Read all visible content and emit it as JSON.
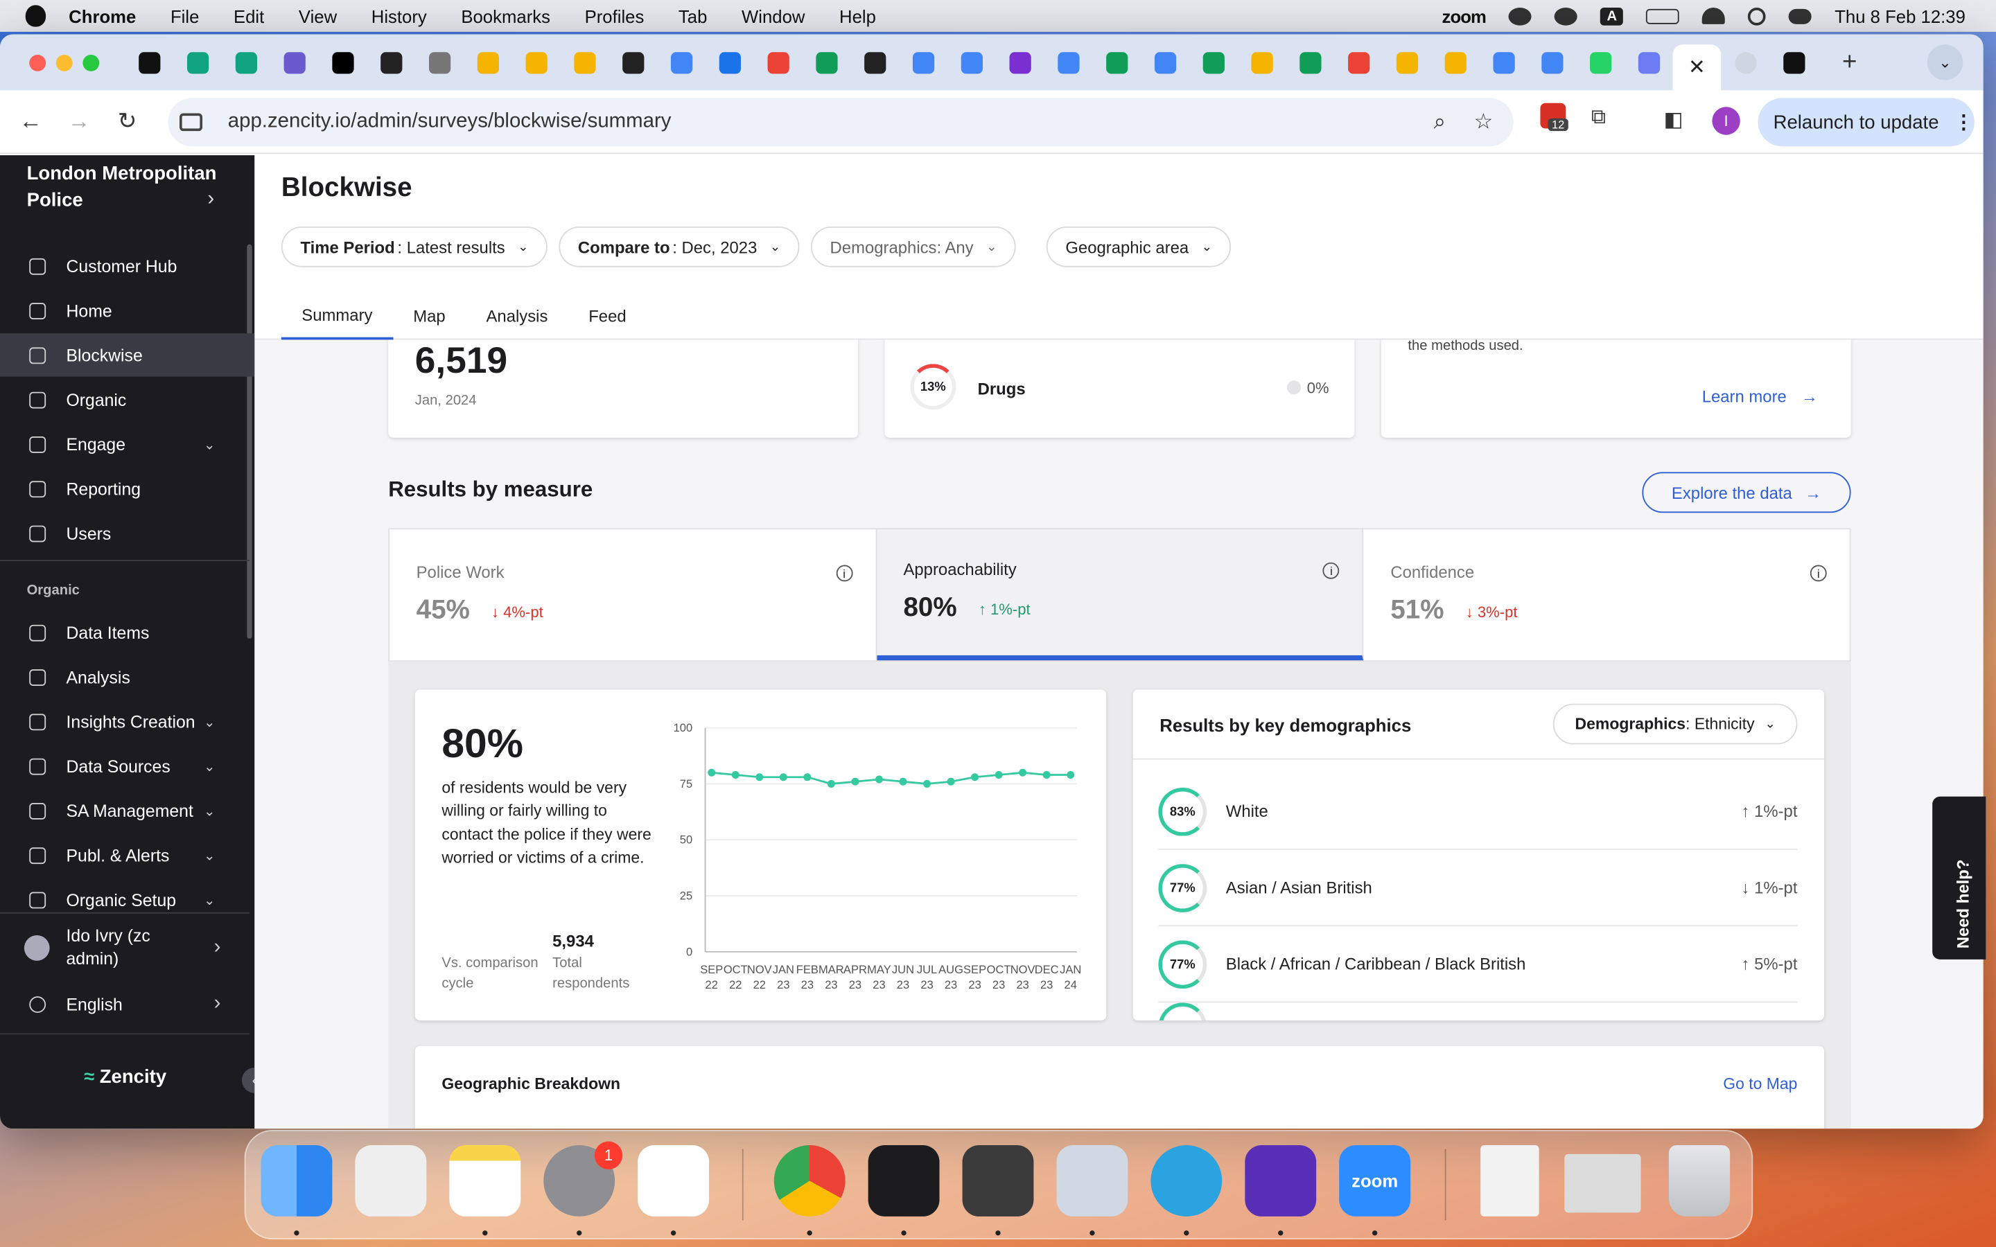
{
  "menubar": {
    "app": "Chrome",
    "items": [
      "File",
      "Edit",
      "View",
      "History",
      "Bookmarks",
      "Profiles",
      "Tab",
      "Window",
      "Help"
    ],
    "zoom": "zoom",
    "a_icon": "A",
    "datetime": "Thu 8 Feb  12:39"
  },
  "browser": {
    "url": "app.zencity.io/admin/surveys/blockwise/summary",
    "relaunch": "Relaunch to update",
    "ext_badge": "12",
    "profile_letter": "I",
    "close_tab": "✕",
    "new_tab": "+"
  },
  "sidebar": {
    "org_name": "London Metropolitan Police",
    "items": [
      {
        "label": "Customer Hub",
        "icon": "home-icon"
      },
      {
        "label": "Home",
        "icon": "home-icon"
      },
      {
        "label": "Blockwise",
        "icon": "survey-icon",
        "selected": true
      },
      {
        "label": "Organic",
        "icon": "globe-icon"
      },
      {
        "label": "Engage",
        "icon": "megaphone-icon",
        "chevron": true
      },
      {
        "label": "Reporting",
        "icon": "report-icon"
      },
      {
        "label": "Users",
        "icon": "user-icon"
      }
    ],
    "section_label": "Organic",
    "items2": [
      {
        "label": "Data Items",
        "icon": "chat-icon"
      },
      {
        "label": "Analysis",
        "icon": "chat-icon"
      },
      {
        "label": "Insights Creation",
        "icon": "bulb-icon",
        "chevron": true
      },
      {
        "label": "Data Sources",
        "icon": "database-icon",
        "chevron": true
      },
      {
        "label": "SA Management",
        "icon": "user-gear-icon",
        "chevron": true
      },
      {
        "label": "Publ. & Alerts",
        "icon": "bell-icon",
        "chevron": true
      },
      {
        "label": "Organic Setup",
        "icon": "gear-icon",
        "chevron": true
      }
    ],
    "user": "Ido Ivry (zc admin)",
    "language": "English",
    "logo": "Zencity"
  },
  "header": {
    "title": "Blockwise",
    "filters": [
      {
        "key": "Time Period",
        "value": "Latest results"
      },
      {
        "key": "Compare to",
        "value": "Dec, 2023"
      },
      {
        "key": "",
        "value": "Demographics: Any"
      },
      {
        "key": "",
        "value": "Geographic area"
      }
    ],
    "tabs": [
      "Summary",
      "Map",
      "Analysis",
      "Feed"
    ]
  },
  "top_cards": {
    "respondents": {
      "value": "6,519",
      "date": "Jan, 2024"
    },
    "issue": {
      "pct": "13%",
      "label": "Drugs",
      "change": "0%"
    },
    "learn": {
      "text": "the methods used.",
      "link": "Learn more"
    }
  },
  "results": {
    "title": "Results by measure",
    "explore": "Explore the data",
    "measures": [
      {
        "label": "Police Work",
        "value": "45%",
        "change": "4%-pt",
        "dir": "down"
      },
      {
        "label": "Approachability",
        "value": "80%",
        "change": "1%-pt",
        "dir": "up",
        "active": true
      },
      {
        "label": "Confidence",
        "value": "51%",
        "change": "3%-pt",
        "dir": "down"
      }
    ]
  },
  "detail": {
    "value": "80%",
    "description": "of residents would be very willing or fairly willing to contact the police if they were worried or victims of a crime.",
    "vs_label": "Vs. comparison cycle",
    "respondents": "5,934",
    "respondents_label": "Total respondents"
  },
  "chart_data": {
    "type": "line",
    "x": [
      "SEP 22",
      "OCT 22",
      "NOV 22",
      "JAN 23",
      "FEB 23",
      "MAR 23",
      "APR 23",
      "MAY 23",
      "JUN 23",
      "JUL 23",
      "AUG 23",
      "SEP 23",
      "OCT 23",
      "NOV 23",
      "DEC 23",
      "JAN 24"
    ],
    "tick_top": [
      "SEP",
      "OCT",
      "NOV",
      "JAN",
      "FEB",
      "MAR",
      "APR",
      "MAY",
      "JUN",
      "JUL",
      "AUG",
      "SEP",
      "OCT",
      "NOV",
      "DEC",
      "JAN"
    ],
    "tick_bottom": [
      "22",
      "22",
      "22",
      "23",
      "23",
      "23",
      "23",
      "23",
      "23",
      "23",
      "23",
      "23",
      "23",
      "23",
      "23",
      "24"
    ],
    "series": [
      {
        "values": [
          80,
          79,
          78,
          78,
          78,
          75,
          76,
          77,
          76,
          75,
          76,
          78,
          79,
          80,
          79,
          79
        ]
      }
    ],
    "ylim": [
      0,
      100
    ],
    "yticks": [
      "0",
      "25",
      "50",
      "75",
      "100"
    ],
    "color": "#34c9a0",
    "grid": true
  },
  "demographics": {
    "title": "Results by key demographics",
    "selector_key": "Demographics",
    "selector_value": "Ethnicity",
    "rows": [
      {
        "pct": "83%",
        "name": "White",
        "change": "1%-pt",
        "dir": "up"
      },
      {
        "pct": "77%",
        "name": "Asian / Asian British",
        "change": "1%-pt",
        "dir": "down"
      },
      {
        "pct": "77%",
        "name": "Black / African / Caribbean / Black British",
        "change": "5%-pt",
        "dir": "up"
      }
    ]
  },
  "geo": {
    "title": "Geographic Breakdown",
    "link": "Go to Map"
  },
  "help": "Need help?",
  "dock_badge": "1",
  "dock_zoom": "zoom"
}
